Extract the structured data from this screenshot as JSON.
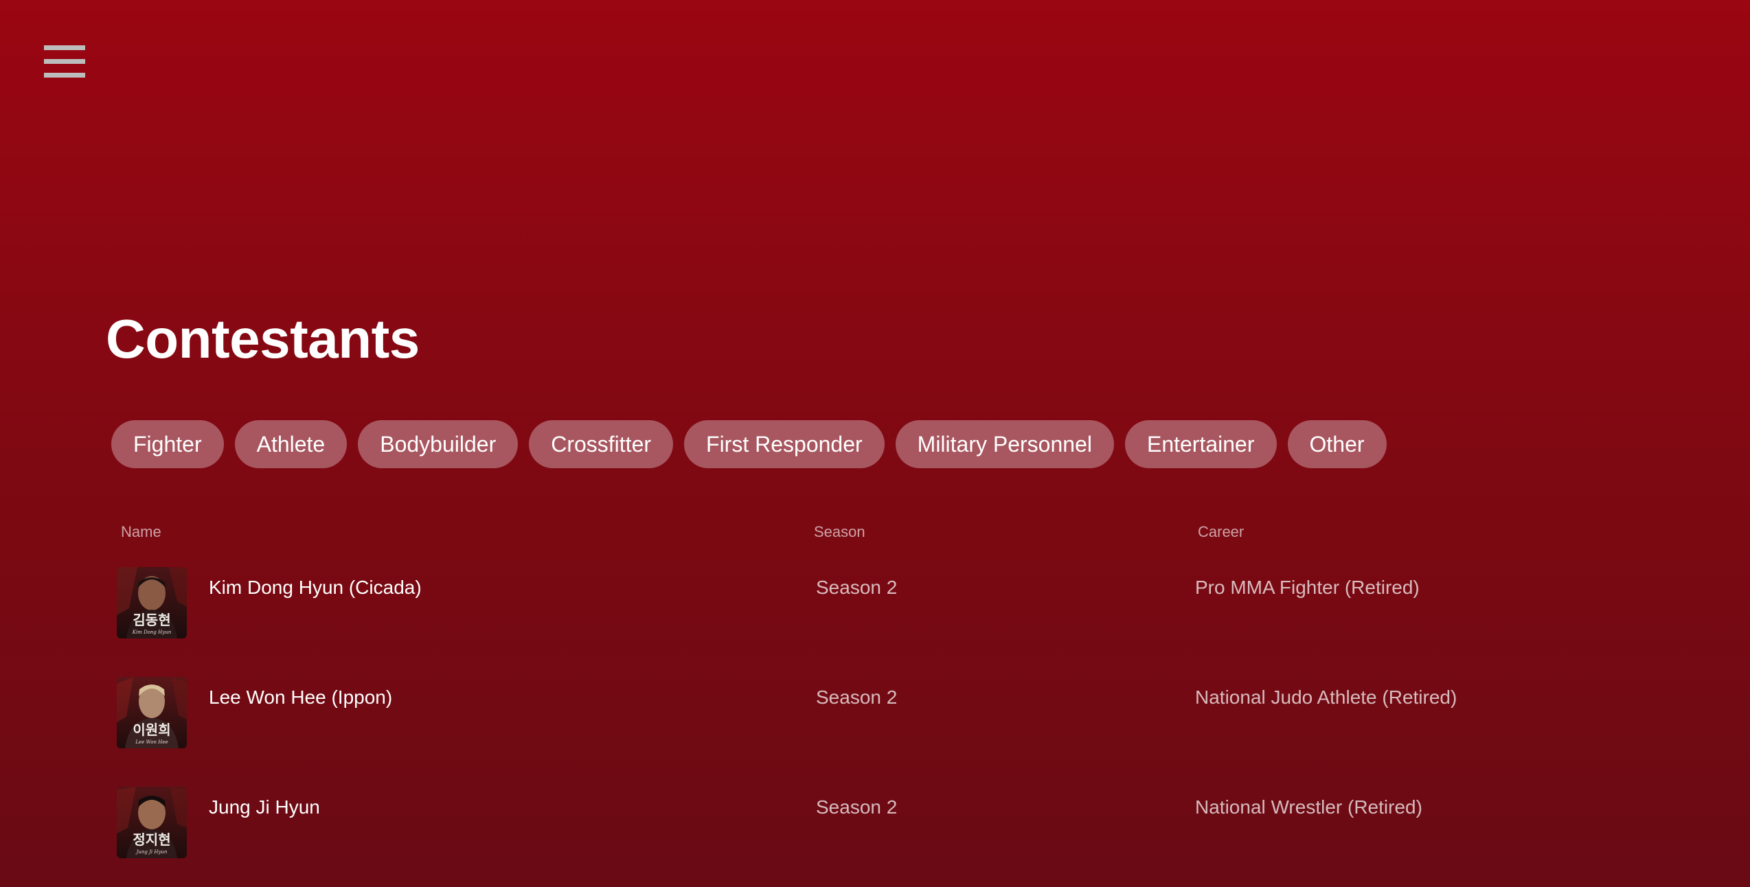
{
  "page": {
    "title": "Contestants"
  },
  "menu": {
    "icon": "hamburger-menu-icon"
  },
  "filters": [
    {
      "label": "Fighter"
    },
    {
      "label": "Athlete"
    },
    {
      "label": "Bodybuilder"
    },
    {
      "label": "Crossfitter"
    },
    {
      "label": "First Responder"
    },
    {
      "label": "Military Personnel"
    },
    {
      "label": "Entertainer"
    },
    {
      "label": "Other"
    }
  ],
  "table": {
    "columns": {
      "name": "Name",
      "season": "Season",
      "career": "Career"
    },
    "rows": [
      {
        "name": "Kim Dong Hyun (Cicada)",
        "season": "Season 2",
        "career": "Pro MMA Fighter (Retired)",
        "thumb_hangul": "김동현",
        "thumb_caption": "Kim Dong Hyun"
      },
      {
        "name": "Lee Won Hee (Ippon)",
        "season": "Season 2",
        "career": "National Judo Athlete (Retired)",
        "thumb_hangul": "이원희",
        "thumb_caption": "Lee Won Hee"
      },
      {
        "name": "Jung Ji Hyun",
        "season": "Season 2",
        "career": "National Wrestler (Retired)",
        "thumb_hangul": "정지현",
        "thumb_caption": "Jung Ji Hyun"
      }
    ]
  },
  "colors": {
    "background_top": "#9a0612",
    "background_bottom": "#690a14",
    "chip_background": "rgba(205,160,168,0.52)",
    "text_primary": "#ffffff",
    "text_muted": "rgba(255,255,255,0.72)"
  }
}
